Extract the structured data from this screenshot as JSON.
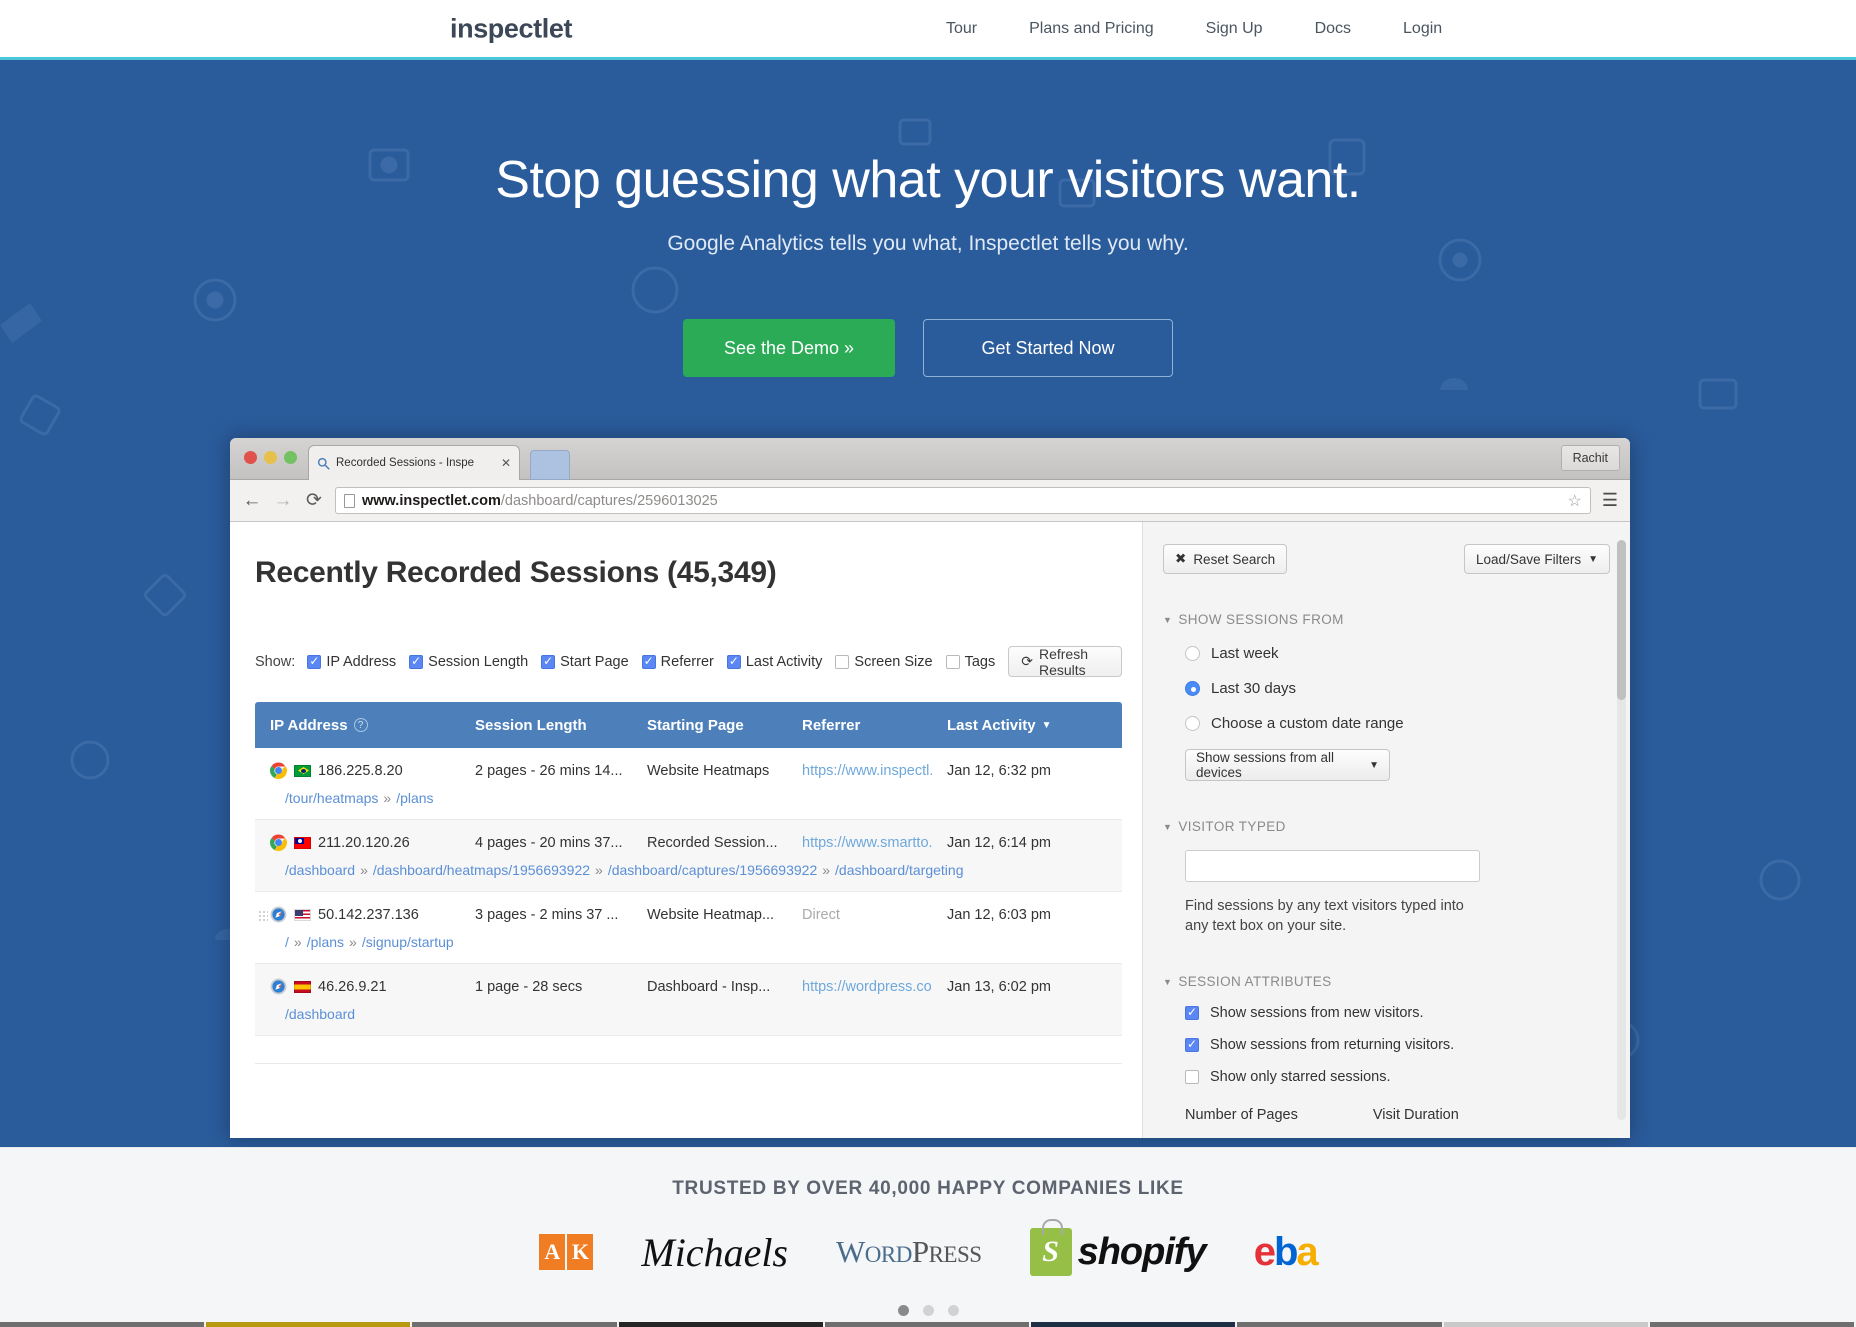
{
  "nav": {
    "brand": "inspectlet",
    "links": [
      {
        "label": "Tour"
      },
      {
        "label": "Plans and Pricing"
      },
      {
        "label": "Sign Up"
      },
      {
        "label": "Docs"
      },
      {
        "label": "Login"
      }
    ]
  },
  "hero": {
    "headline": "Stop guessing what your visitors want.",
    "subhead": "Google Analytics tells you what, Inspectlet tells you why.",
    "cta_primary": "See the Demo »",
    "cta_secondary": "Get Started Now",
    "bg_color": "#2a5b9b",
    "accent_green": "#2bab56",
    "top_rule_color": "#4cc6d9"
  },
  "browser": {
    "tab_title": "Recorded Sessions - Inspe",
    "tab_close": "✕",
    "profile_label": "Rachit",
    "url_bold": "www.inspectlet.com",
    "url_rest": "/dashboard/captures/2596013025",
    "back_icon": "←",
    "forward_icon": "→",
    "reload_icon": "⟳",
    "star_icon": "☆",
    "menu_icon": "☰"
  },
  "dashboard": {
    "title": "Recently Recorded Sessions (45,349)",
    "show_label": "Show:",
    "show_options": [
      {
        "label": "IP Address",
        "checked": true
      },
      {
        "label": "Session Length",
        "checked": true
      },
      {
        "label": "Start Page",
        "checked": true
      },
      {
        "label": "Referrer",
        "checked": true
      },
      {
        "label": "Last Activity",
        "checked": true
      },
      {
        "label": "Screen Size",
        "checked": false
      },
      {
        "label": "Tags",
        "checked": false
      }
    ],
    "refresh_label": "Refresh Results",
    "refresh_icon": "⟳",
    "table": {
      "headers": [
        "IP Address",
        "Session Length",
        "Starting Page",
        "Referrer",
        "Last Activity"
      ],
      "header_help_icon": "?",
      "sort_caret": "▼",
      "header_bg": "#4d80bb",
      "rows": [
        {
          "browser": "chrome",
          "country": "br",
          "ip": "186.225.8.20",
          "length": "2 pages - 26 mins 14...",
          "start_page": "Website Heatmaps",
          "referrer": "https://www.inspectl...",
          "referrer_is_link": true,
          "last_activity": "Jan 12, 6:32 pm",
          "paths": [
            "/tour/heatmaps",
            "/plans"
          ]
        },
        {
          "browser": "chrome",
          "country": "tw",
          "ip": "211.20.120.26",
          "length": "4 pages - 20 mins 37...",
          "start_page": "Recorded Session...",
          "referrer": "https://www.smartto...",
          "referrer_is_link": true,
          "last_activity": "Jan 12, 6:14 pm",
          "paths": [
            "/dashboard",
            "/dashboard/heatmaps/1956693922",
            "/dashboard/captures/1956693922",
            "/dashboard/targeting"
          ]
        },
        {
          "browser": "safari",
          "country": "us",
          "ip": "50.142.237.136",
          "length": "3 pages - 2 mins 37 ...",
          "start_page": "Website Heatmap...",
          "referrer": "Direct",
          "referrer_is_link": false,
          "last_activity": "Jan 12, 6:03 pm",
          "paths": [
            "/",
            "/plans",
            "/signup/startup"
          ]
        },
        {
          "browser": "safari",
          "country": "es",
          "ip": "46.26.9.21",
          "length": "1 page - 28 secs",
          "start_page": "Dashboard - Insp...",
          "referrer": "https://wordpress.co...",
          "referrer_is_link": true,
          "last_activity": "Jan 13, 6:02 pm",
          "paths": [
            "/dashboard"
          ]
        }
      ]
    },
    "sidebar": {
      "reset_label": "Reset Search",
      "reset_icon": "✖",
      "filters_label": "Load/Save Filters",
      "caret": "▼",
      "section_sessions_from": "SHOW SESSIONS FROM",
      "radios": [
        {
          "label": "Last week",
          "selected": false
        },
        {
          "label": "Last 30 days",
          "selected": true
        },
        {
          "label": "Choose a custom date range",
          "selected": false
        }
      ],
      "device_select": "Show sessions from all devices",
      "section_visitor_typed": "VISITOR TYPED",
      "typed_value": "",
      "typed_help": "Find sessions by any text visitors typed into any text box on your site.",
      "section_session_attributes": "SESSION ATTRIBUTES",
      "attributes": [
        {
          "label": "Show sessions from new visitors.",
          "checked": true
        },
        {
          "label": "Show sessions from returning visitors.",
          "checked": true
        },
        {
          "label": "Show only starred sessions.",
          "checked": false
        }
      ],
      "footer_left": "Number of Pages",
      "footer_right": "Visit Duration"
    }
  },
  "trusted": {
    "heading": "TRUSTED BY OVER 40,000 HAPPY COMPANIES LIKE",
    "logos": [
      {
        "name": "ak-steel",
        "text": "AK"
      },
      {
        "name": "michaels",
        "text": "Michaels"
      },
      {
        "name": "wordpress",
        "text": "WORDPRESS"
      },
      {
        "name": "shopify",
        "text": "shopify"
      },
      {
        "name": "ebay",
        "text": "ebay"
      }
    ]
  },
  "carousel": {
    "dots": [
      {
        "active": true
      },
      {
        "active": false
      },
      {
        "active": false
      }
    ]
  }
}
